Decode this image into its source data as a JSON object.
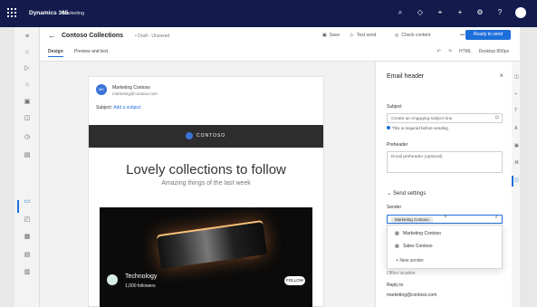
{
  "topbar": {
    "brand": "Dynamics 365",
    "app": "Marketing",
    "icons": [
      "search-icon",
      "lightbulb-icon",
      "help-icon",
      "plus-icon",
      "settings-icon",
      "question-icon",
      "avatar-icon"
    ]
  },
  "left_nav": {
    "icons": [
      "home-icon",
      "recent-icon",
      "pin-icon",
      "people-icon",
      "segment-icon",
      "journey-icon",
      "analytics-icon",
      "forms-icon",
      "email-icon",
      "templates-icon",
      "calendar-icon",
      "assets-icon",
      "settings-icon"
    ]
  },
  "editor": {
    "title": "Contoso Collections",
    "draft_status": "• Draft - Unsaved",
    "tabs": [
      "Design",
      "Preview and test"
    ],
    "save": "Save",
    "test_send": "Test send",
    "check_content": "Check content",
    "more": "•••",
    "ready_to_send": "Ready to send",
    "toolbar": [
      "↶",
      "↷",
      "HTML",
      "Desktop 800px"
    ]
  },
  "email": {
    "sender_initials": "MC",
    "sender_name": "Marketing Contoso",
    "sender_email": "marketing@contoso.com",
    "subject_label": "Subject:",
    "subject_link": "Add a subject",
    "brand_text": "CONTOSO",
    "headline": "Lovely collections to follow",
    "subheadline": "Amazing things of the last week",
    "card_title": "Technology",
    "card_followers": "1,000 followers",
    "follow_button": "FOLLOW"
  },
  "panel": {
    "title": "Email header",
    "subject_label": "Subject",
    "subject_placeholder": "Create an engaging subject line",
    "subject_hint": "This is required before sending",
    "preheader_label": "Preheader",
    "preheader_placeholder": "Email preheader (optional)",
    "send_settings": "Send settings",
    "sender_label": "Sender",
    "selected_sender": "Marketing Contoso",
    "options": [
      "Marketing Contoso",
      "Sales Contoso"
    ],
    "new_sender": "New sender",
    "from_hint": "Office location",
    "reply_to_label": "Reply to",
    "reply_to_value": "marketing@contoso.com"
  },
  "colors": {
    "top_bar": "#121b4c",
    "accent": "#1e6fd9",
    "panel_bg": "#ffffff"
  }
}
